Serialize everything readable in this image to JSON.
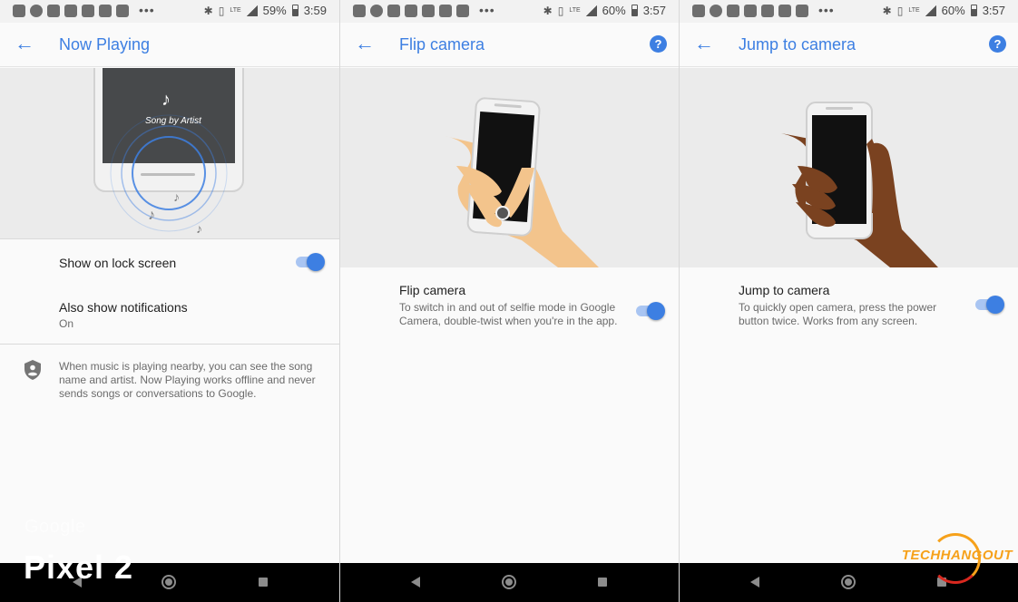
{
  "colors": {
    "accent": "#3d7fe2",
    "toggle_track": "#a9c5f2",
    "hero_bg": "#ebebeb",
    "skin_light": "#f3c48c",
    "skin_dark": "#7a4220"
  },
  "panels": [
    {
      "status": {
        "battery": "59%",
        "time": "3:59"
      },
      "title": "Now Playing",
      "illustration_caption": "Song by Artist",
      "settings": [
        {
          "title": "Show on lock screen",
          "toggle_on": true
        },
        {
          "title": "Also show notifications",
          "subtitle": "On"
        }
      ],
      "info_text": "When music is playing nearby, you can see the song name and artist. Now Playing works offline and never sends songs or conversations to Google."
    },
    {
      "status": {
        "battery": "60%",
        "time": "3:57"
      },
      "title": "Flip camera",
      "setting": {
        "title": "Flip camera",
        "description": "To switch in and out of selfie mode in Google Camera, double-twist when you're in the app.",
        "toggle_on": true
      }
    },
    {
      "status": {
        "battery": "60%",
        "time": "3:57"
      },
      "title": "Jump to camera",
      "setting": {
        "title": "Jump to camera",
        "description": "To quickly open camera, press the power button twice. Works from any screen.",
        "toggle_on": true
      }
    }
  ],
  "icons": {
    "back": "arrow-back-icon",
    "help": "help-icon",
    "shield": "shield-account-icon",
    "music_note": "music-note-icon"
  },
  "glyphs": {
    "back_arrow": "←",
    "help_mark": "?",
    "more_dots": "•••",
    "bluetooth": "✱",
    "vibrate": "▯",
    "lte": "LTE",
    "music_note": "♪"
  },
  "watermarks": {
    "google": "Google",
    "pixel": "Pixel 2",
    "techhangout": "TECHHANGOUT"
  }
}
